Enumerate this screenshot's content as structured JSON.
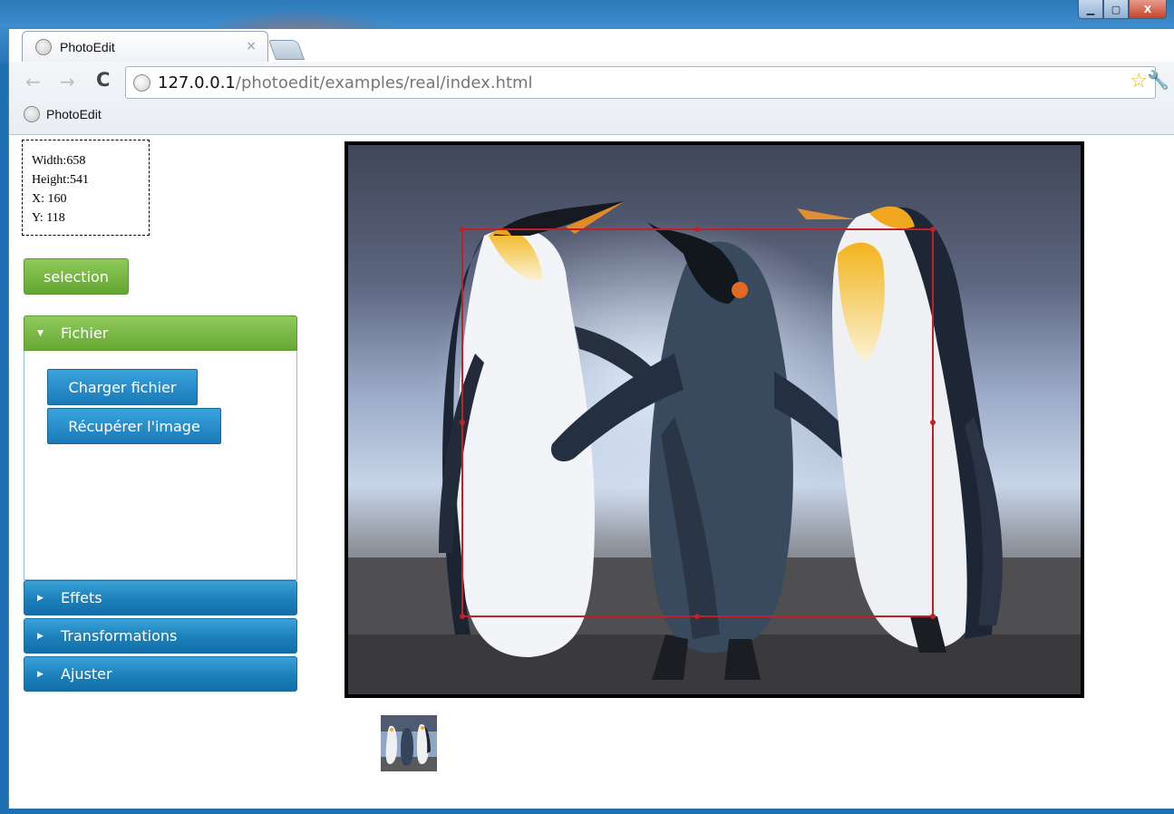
{
  "window": {
    "minimize_glyph": "▁",
    "maximize_glyph": "▢",
    "close_glyph": "X"
  },
  "tab": {
    "title": "PhotoEdit",
    "close_glyph": "×",
    "icon": "globe-icon"
  },
  "toolbar": {
    "back_glyph": "←",
    "forward_glyph": "→",
    "reload_glyph": "C",
    "url_host": "127.0.0.1",
    "url_path": "/photoedit/examples/real/index.html",
    "star_glyph": "☆",
    "wrench_glyph": "🔧"
  },
  "bookmarks": {
    "items": [
      {
        "label": "PhotoEdit",
        "icon": "globe-icon"
      }
    ]
  },
  "info": {
    "width": "Width:658",
    "height": "Height:541",
    "x": "X: 160",
    "y": "Y: 118"
  },
  "selection_button": "selection",
  "accordion": {
    "sections": [
      {
        "label": "Fichier",
        "expanded": true
      },
      {
        "label": "Effets",
        "expanded": false
      },
      {
        "label": "Transformations",
        "expanded": false
      },
      {
        "label": "Ajuster",
        "expanded": false
      }
    ],
    "fichier_buttons": [
      "Charger fichier",
      "Récupérer l'image"
    ],
    "expanded_arrow": "▼",
    "collapsed_arrow": "▶"
  },
  "colors": {
    "accent_green": "#66a833",
    "accent_blue": "#1c7fba",
    "selection_red": "#c0202a"
  }
}
